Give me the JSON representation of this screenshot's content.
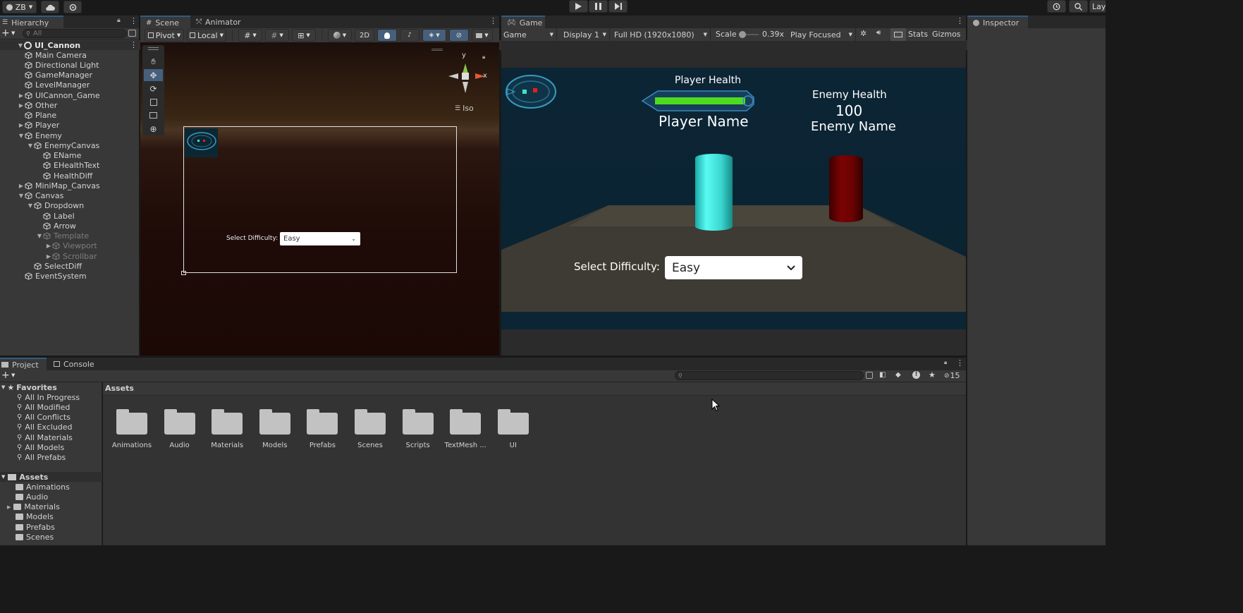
{
  "top": {
    "account": "ZB",
    "layout_label": "Lay"
  },
  "hierarchy": {
    "tab": "Hierarchy",
    "search_placeholder": "All",
    "scene": "UI_Cannon",
    "items": [
      {
        "label": "Main Camera"
      },
      {
        "label": "Directional Light"
      },
      {
        "label": "GameManager"
      },
      {
        "label": "LevelManager"
      },
      {
        "label": "UICannon_Game"
      },
      {
        "label": "Other"
      },
      {
        "label": "Plane"
      },
      {
        "label": "Player"
      },
      {
        "label": "Enemy"
      },
      {
        "label": "EnemyCanvas"
      },
      {
        "label": "EName"
      },
      {
        "label": "EHealthText"
      },
      {
        "label": "HealthDiff"
      },
      {
        "label": "MiniMap_Canvas"
      },
      {
        "label": "Canvas"
      },
      {
        "label": "Dropdown"
      },
      {
        "label": "Label"
      },
      {
        "label": "Arrow"
      },
      {
        "label": "Template"
      },
      {
        "label": "Viewport"
      },
      {
        "label": "Scrollbar"
      },
      {
        "label": "SelectDiff"
      },
      {
        "label": "EventSystem"
      }
    ]
  },
  "scene": {
    "tabs": [
      "Scene",
      "Animator"
    ],
    "pivot": "Pivot",
    "local": "Local",
    "mode_2d": "2D",
    "iso": "Iso",
    "gizmo_y": "y",
    "gizmo_x": "x",
    "select_label": "Select Difficulty:",
    "dropdown_value": "Easy"
  },
  "game": {
    "tab": "Game",
    "view_select": "Game",
    "display": "Display 1",
    "resolution": "Full HD (1920x1080)",
    "scale_label": "Scale",
    "scale_value": "0.39x",
    "play_mode": "Play Focused",
    "stats": "Stats",
    "gizmos": "Gizmos",
    "player_health": "Player Health",
    "player_name": "Player Name",
    "enemy_health_label": "Enemy Health",
    "enemy_health_value": "100",
    "enemy_name": "Enemy Name",
    "select_label": "Select Difficulty:",
    "dropdown_value": "Easy"
  },
  "inspector": {
    "tab": "Inspector"
  },
  "project": {
    "tabs": [
      "Project",
      "Console"
    ],
    "hidden_count": "15",
    "favorites_title": "Favorites",
    "favorites": [
      "All In Progress",
      "All Modified",
      "All Conflicts",
      "All Excluded",
      "All Materials",
      "All Models",
      "All Prefabs"
    ],
    "assets_title": "Assets",
    "asset_tree": [
      "Animations",
      "Audio",
      "Materials",
      "Models",
      "Prefabs",
      "Scenes"
    ],
    "breadcrumb": "Assets",
    "folders": [
      "Animations",
      "Audio",
      "Materials",
      "Models",
      "Prefabs",
      "Scenes",
      "Scripts",
      "TextMesh ...",
      "UI"
    ]
  }
}
